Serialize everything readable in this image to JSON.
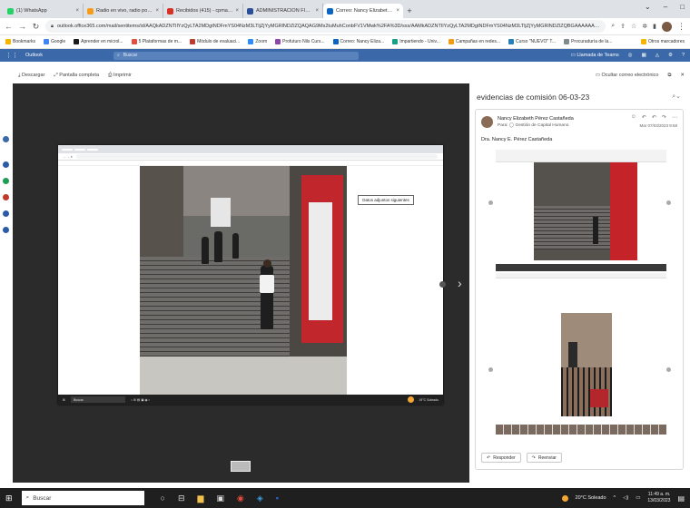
{
  "browser": {
    "tabs": [
      {
        "label": "(1) WhatsApp",
        "color": "#25d366",
        "active": false
      },
      {
        "label": "Radio en vivo, radio por inter",
        "color": "#f59c1a",
        "active": false
      },
      {
        "label": "Recibidos (415) - cpmancyel@g",
        "color": "#d93025",
        "active": false
      },
      {
        "label": "ADMINISTRACION FINANCIERA",
        "color": "#2a4f99",
        "active": false
      },
      {
        "label": "Correo: Nancy Elizabeth Pérez Ca",
        "color": "#0a64c2",
        "active": true
      }
    ],
    "new_tab": "+",
    "url": "outlook.office365.com/mail/sentitems/id/AAQkADZNTIlYzQyLTA2MDgtNDFmYS04NzM3LTljZjYyMGRlNDZlZQAQAG9Ms2tuMuhConbFV1VMwk%2FA%3D/sxs/AAMkADZNTIlYzQyLTA2MDgtNDFmYS04NzM3LTljZjYyMGRlNDZlZQBGAAAAAACRA..."
  },
  "bookmarks": {
    "items": [
      {
        "label": "Bookmarks",
        "color": "#f4b400"
      },
      {
        "label": "Google",
        "color": "#4285f4"
      },
      {
        "label": "Aprender en microl...",
        "color": "#1a1a1a"
      },
      {
        "label": "5 Plataformas de m...",
        "color": "#e74c3c"
      },
      {
        "label": "Módulo de evaluaci...",
        "color": "#c0392b"
      },
      {
        "label": "Zoom",
        "color": "#2d8cff"
      },
      {
        "label": "Profuturo Nils Curs...",
        "color": "#8e44ad"
      },
      {
        "label": "Correo: Nancy Eliza...",
        "color": "#0a64c2"
      },
      {
        "label": "Impartiendo - Univ...",
        "color": "#16a085"
      },
      {
        "label": "Campañas en redes...",
        "color": "#f39c12"
      },
      {
        "label": "Curso \"NUEVO\" T...",
        "color": "#2980b9"
      },
      {
        "label": "Procuraduría de la...",
        "color": "#7f8c8d"
      }
    ],
    "other": "Otros marcadores"
  },
  "outlook": {
    "app_name": "Outlook",
    "search_placeholder": "Buscar",
    "meet": "Llamada de Teams"
  },
  "viewer_toolbar": {
    "download": "Descargar",
    "fullscreen": "Pantalla completa",
    "print": "Imprimir",
    "hide_mail": "Ocultar correo electrónico"
  },
  "screenshot": {
    "tooltip": "Datos adjuntos siguientes",
    "taskbar_search": "Buscar",
    "weather": "19°C Soleado"
  },
  "mail": {
    "subject": "evidencias de comisión 06-03-23",
    "from": "Nancy Elizabeth Pérez Castañeda",
    "to": "Para: ◯ Gestión de Capital Humano",
    "date": "Mar 07/03/2023 9:58",
    "greeting": "Dra. Nancy E. Pérez Castañeda",
    "reply": "Responder",
    "forward": "Reenviar"
  },
  "taskbar": {
    "search": "Buscar",
    "weather": "20°C Soleado",
    "time": "11:49 a. m.",
    "date": "13/03/2023"
  }
}
